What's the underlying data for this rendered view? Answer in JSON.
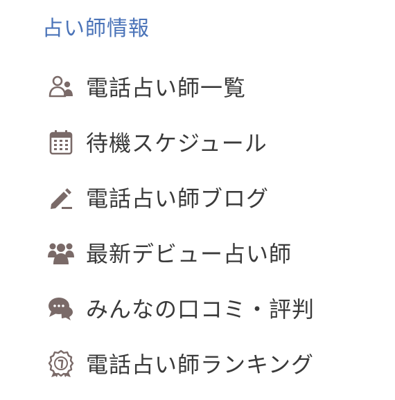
{
  "section": {
    "title": "占い師情報",
    "accent_color": "#4a73b8"
  },
  "menu": {
    "items": [
      {
        "label": "電話占い師一覧",
        "icon": "people-icon"
      },
      {
        "label": "待機スケジュール",
        "icon": "calendar-icon"
      },
      {
        "label": "電話占い師ブログ",
        "icon": "pencil-icon"
      },
      {
        "label": "最新デビュー占い師",
        "icon": "group-icon"
      },
      {
        "label": "みんなの口コミ・評判",
        "icon": "chat-bubbles-icon"
      },
      {
        "label": "電話占い師ランキング",
        "icon": "ranking-medal-icon"
      }
    ],
    "icon_color": "#7a6a68",
    "text_color": "#3a3a3a"
  }
}
